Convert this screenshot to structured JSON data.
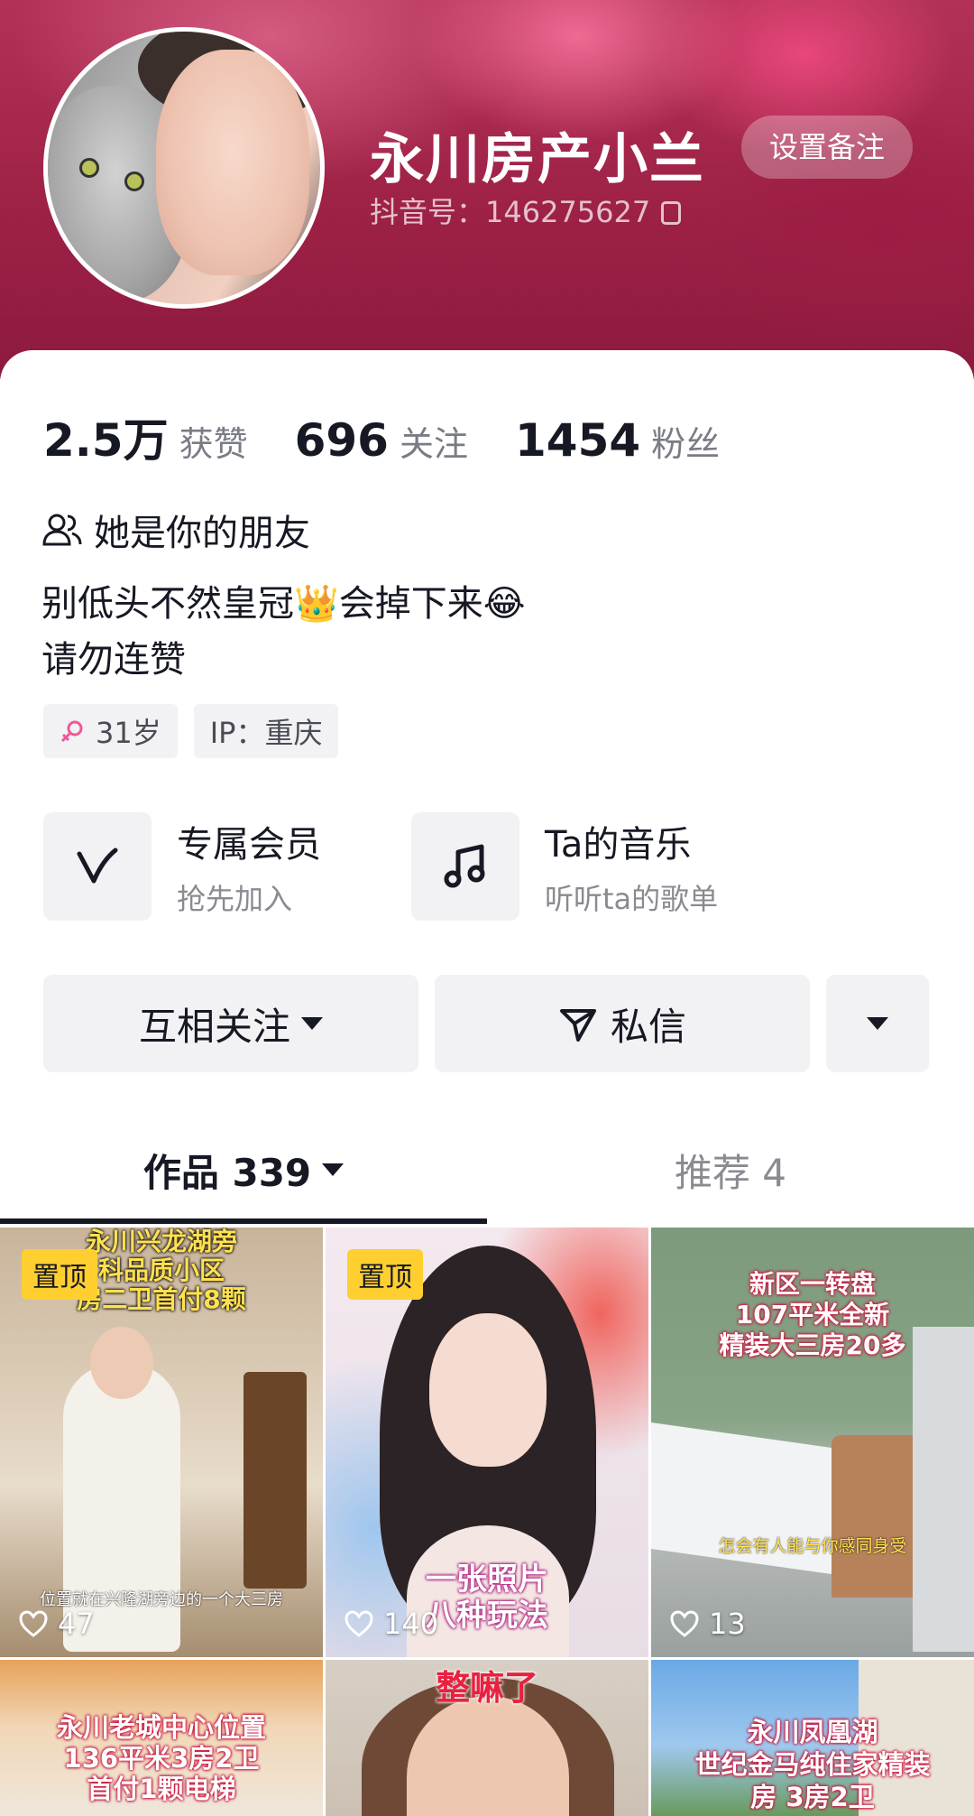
{
  "profile": {
    "username": "永川房产小兰",
    "remark_button": "设置备注",
    "douyin_id": "抖音号：146275627"
  },
  "stats": [
    {
      "value": "2.5万",
      "label": "获赞"
    },
    {
      "value": "696",
      "label": "关注"
    },
    {
      "value": "1454",
      "label": "粉丝"
    }
  ],
  "friend_status": "她是你的朋友",
  "bio": "别低头不然皇冠👑会掉下来😂\n请勿连赞",
  "tags": {
    "age": "31岁",
    "ip": "IP：重庆"
  },
  "features": [
    {
      "title": "专属会员",
      "subtitle": "抢先加入",
      "icon": "vip-v-icon"
    },
    {
      "title": "Ta的音乐",
      "subtitle": "听听ta的歌单",
      "icon": "music-note-icon"
    }
  ],
  "actions": {
    "follow": "互相关注",
    "message": "私信"
  },
  "tabs": [
    {
      "label": "作品 339",
      "active": true
    },
    {
      "label": "推荐 4",
      "active": false
    }
  ],
  "videos": [
    {
      "pinned": "置顶",
      "likes": "47",
      "title": "永川兴龙湖旁\n科品质小区\n房二卫首付8颗",
      "caption": "位置就在兴隆湖旁边的一个大三房"
    },
    {
      "pinned": "置顶",
      "likes": "140",
      "title": "一张照片\n八种玩法",
      "caption": ""
    },
    {
      "pinned": "",
      "likes": "13",
      "title": "新区一转盘\n107平米全新\n精装大三房20多",
      "caption": "怎会有人能与你感同身受"
    },
    {
      "pinned": "",
      "likes": "",
      "title": "永川老城中心位置\n136平米3房2卫\n首付1颗电梯",
      "caption": ""
    },
    {
      "pinned": "",
      "likes": "",
      "title": "整嘛了",
      "caption": ""
    },
    {
      "pinned": "",
      "likes": "",
      "title": "永川凤凰湖\n世纪金马纯住家精装\n房 3房2卫",
      "caption": ""
    }
  ],
  "colors": {
    "pin_yellow": "#fecf2f",
    "banner_pink": "#b23257",
    "overlay_red": "#c8183f"
  }
}
